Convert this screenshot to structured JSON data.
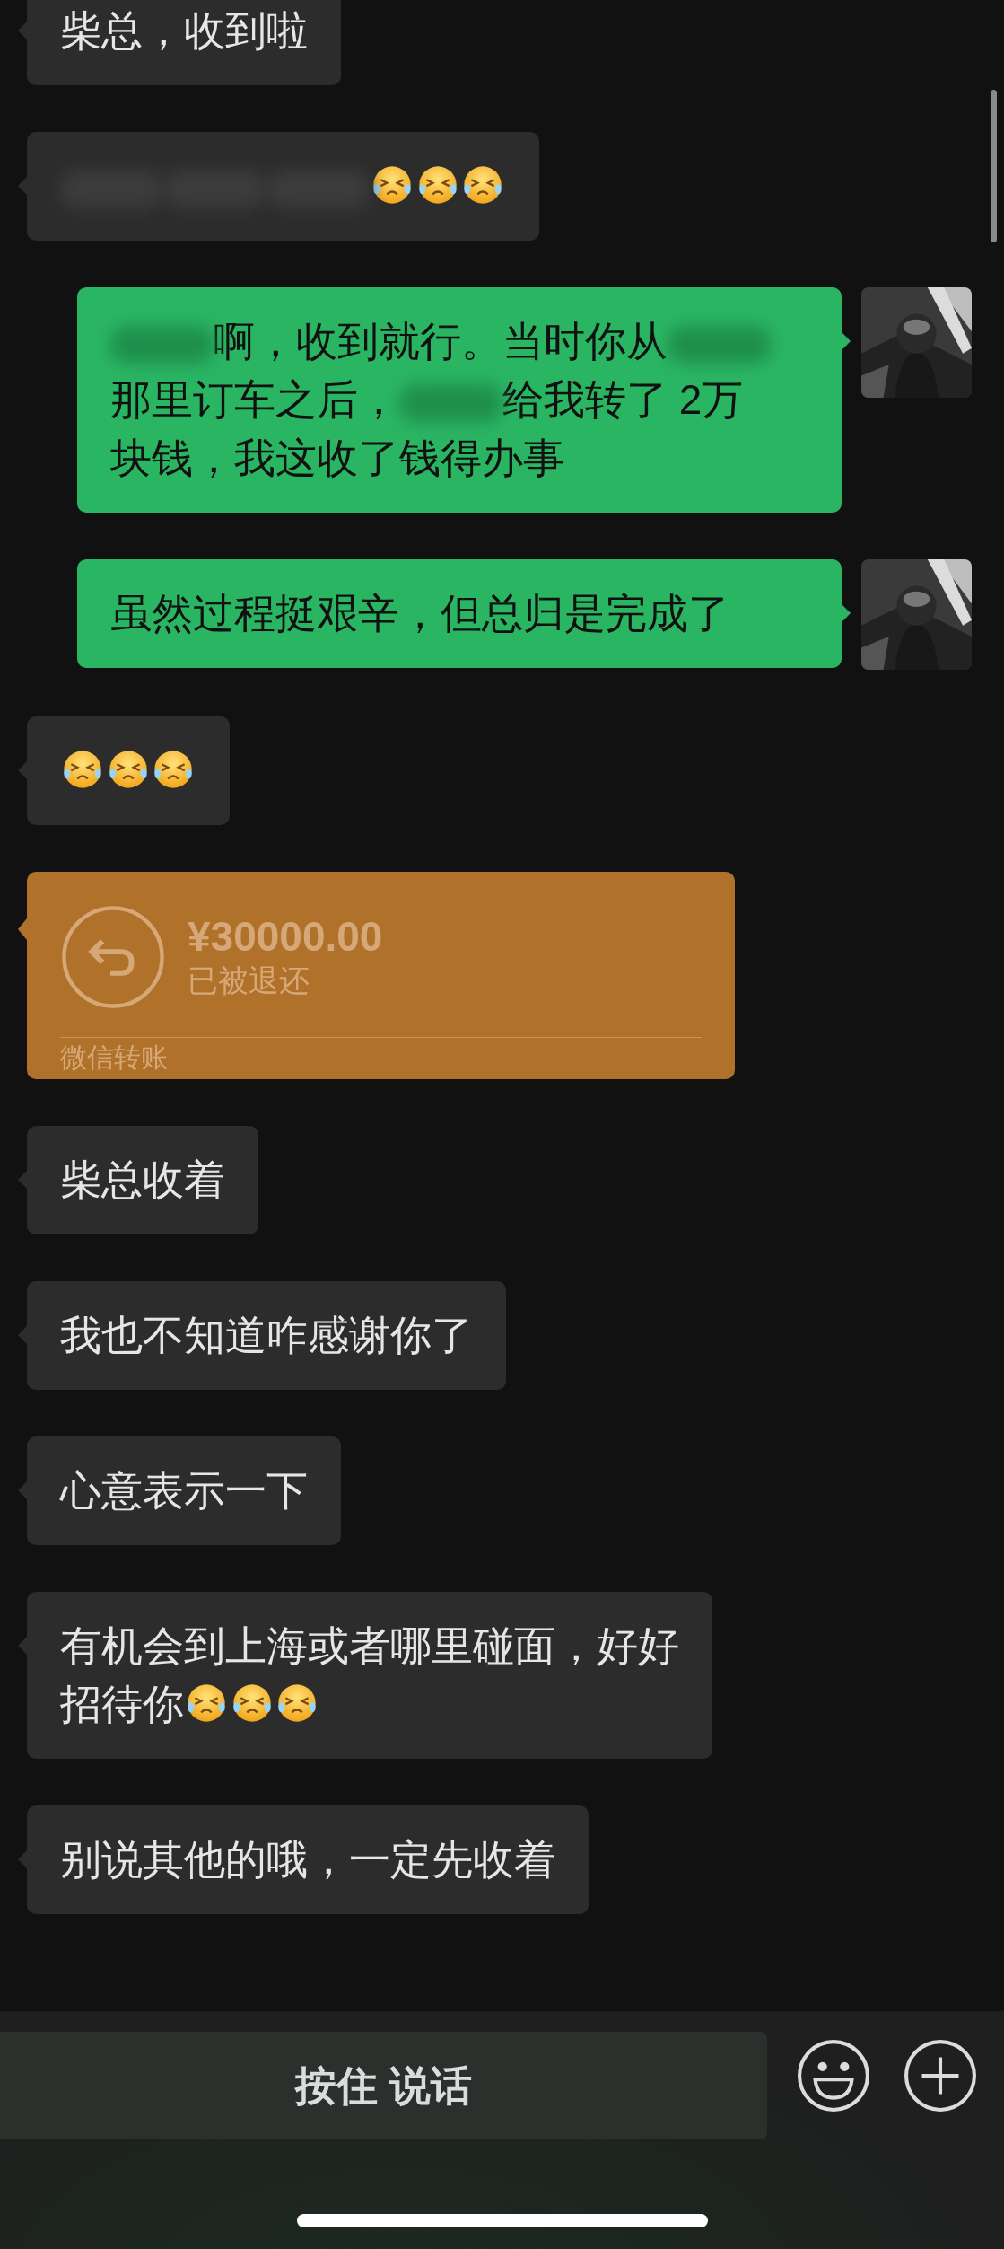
{
  "messages": [
    {
      "outgoing": false,
      "kind": "text",
      "lines": [
        {
          "segments": [
            {
              "kind": "text",
              "text": "柴总，收到啦"
            }
          ]
        }
      ]
    },
    {
      "outgoing": false,
      "kind": "text",
      "lines": [
        {
          "segments": [
            {
              "kind": "blur"
            },
            {
              "kind": "blur"
            },
            {
              "kind": "blur"
            },
            {
              "kind": "emoji"
            },
            {
              "kind": "emoji"
            },
            {
              "kind": "emoji"
            }
          ]
        }
      ]
    },
    {
      "outgoing": true,
      "kind": "text",
      "avatar": {
        "kind": "picture"
      },
      "lines": [
        {
          "segments": [
            {
              "kind": "blur"
            },
            {
              "kind": "text",
              "text": "啊，收到就行。当时你从"
            },
            {
              "kind": "blur"
            }
          ]
        },
        {
          "segments": [
            {
              "kind": "text",
              "text": "那里订车之后，"
            },
            {
              "kind": "blur"
            },
            {
              "kind": "text",
              "text": "给我转了 2万"
            }
          ]
        },
        {
          "segments": [
            {
              "kind": "text",
              "text": "块钱，我这收了钱得办事"
            }
          ]
        }
      ]
    },
    {
      "outgoing": true,
      "kind": "text",
      "avatar": {
        "kind": "picture"
      },
      "lines": [
        {
          "segments": [
            {
              "kind": "text",
              "text": "虽然过程挺艰辛，但总归是完成了"
            }
          ]
        }
      ]
    },
    {
      "outgoing": false,
      "kind": "text",
      "lines": [
        {
          "segments": [
            {
              "kind": "emoji"
            },
            {
              "kind": "emoji"
            },
            {
              "kind": "emoji"
            }
          ]
        }
      ]
    },
    {
      "outgoing": false,
      "kind": "transfer",
      "amount": "¥30000.00",
      "status": "已被退还",
      "label": "微信转账"
    },
    {
      "outgoing": false,
      "kind": "text",
      "lines": [
        {
          "segments": [
            {
              "kind": "text",
              "text": "柴总收着"
            }
          ]
        }
      ]
    },
    {
      "outgoing": false,
      "kind": "text",
      "lines": [
        {
          "segments": [
            {
              "kind": "text",
              "text": "我也不知道咋感谢你了"
            }
          ]
        }
      ]
    },
    {
      "outgoing": false,
      "kind": "text",
      "lines": [
        {
          "segments": [
            {
              "kind": "text",
              "text": "心意表示一下"
            }
          ]
        }
      ]
    },
    {
      "outgoing": false,
      "kind": "text",
      "lines": [
        {
          "segments": [
            {
              "kind": "text",
              "text": "有机会到上海或者哪里碰面，好好"
            }
          ]
        },
        {
          "segments": [
            {
              "kind": "text",
              "text": "招待你"
            },
            {
              "kind": "emoji"
            },
            {
              "kind": "emoji"
            },
            {
              "kind": "emoji"
            }
          ]
        }
      ]
    },
    {
      "outgoing": false,
      "kind": "text",
      "lines": [
        {
          "segments": [
            {
              "kind": "text",
              "text": "别说其他的哦，一定先收着"
            }
          ]
        }
      ]
    }
  ],
  "input_bar": {
    "voice_button": "按住 说话"
  }
}
